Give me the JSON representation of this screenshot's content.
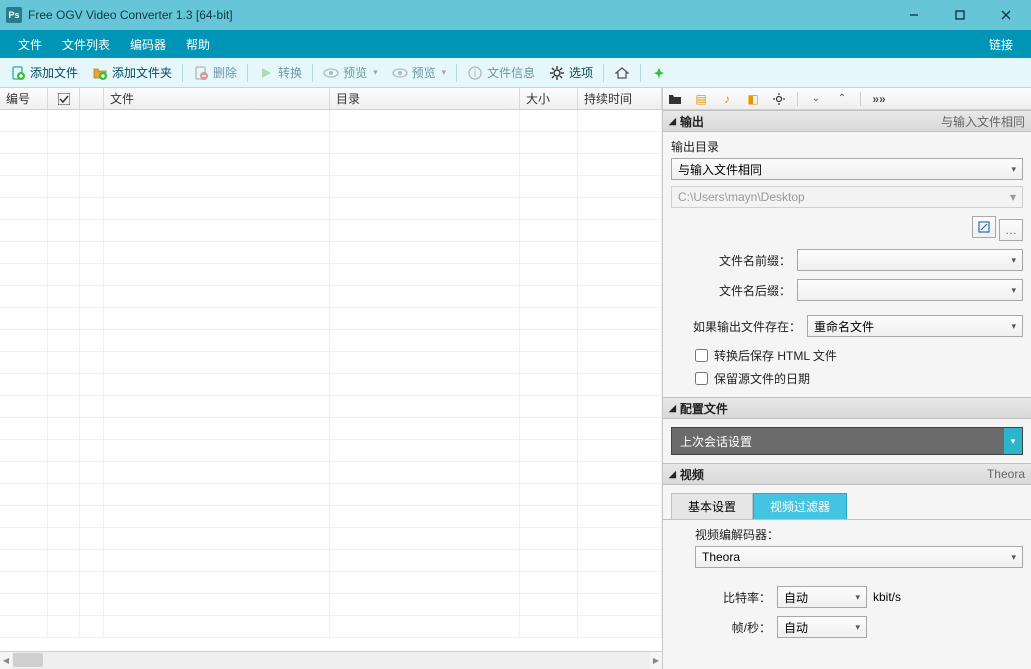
{
  "window": {
    "title": "Free OGV Video Converter 1.3  [64-bit]",
    "icon_text": "Ps"
  },
  "menu": {
    "file": "文件",
    "filelist": "文件列表",
    "encoder": "编码器",
    "help": "帮助",
    "link": "链接"
  },
  "toolbar": {
    "add_file": "添加文件",
    "add_folder": "添加文件夹",
    "delete": "删除",
    "convert": "转换",
    "preview1": "预览",
    "preview2": "预览",
    "file_info": "文件信息",
    "options": "选项"
  },
  "grid": {
    "col_num": "编号",
    "col_file": "文件",
    "col_dir": "目录",
    "col_size": "大小",
    "col_dur": "持续时间"
  },
  "panel": {
    "output_title": "输出",
    "output_hint": "与输入文件相同",
    "output_dir_label": "输出目录",
    "output_dir_value": "与输入文件相同",
    "output_path": "C:\\Users\\mayn\\Desktop",
    "prefix_label": "文件名前缀：",
    "suffix_label": "文件名后缀：",
    "exists_label": "如果输出文件存在：",
    "exists_value": "重命名文件",
    "chk_html": "转换后保存 HTML 文件",
    "chk_date": "保留源文件的日期",
    "profile_title": "配置文件",
    "profile_value": "上次会话设置",
    "video_title": "视频",
    "video_hint": "Theora",
    "tab_basic": "基本设置",
    "tab_filter": "视频过滤器",
    "codec_label": "视频编解码器：",
    "codec_value": "Theora",
    "bitrate_label": "比特率：",
    "bitrate_value": "自动",
    "bitrate_unit": "kbit/s",
    "fps_label": "帧/秒：",
    "fps_value": "自动"
  }
}
